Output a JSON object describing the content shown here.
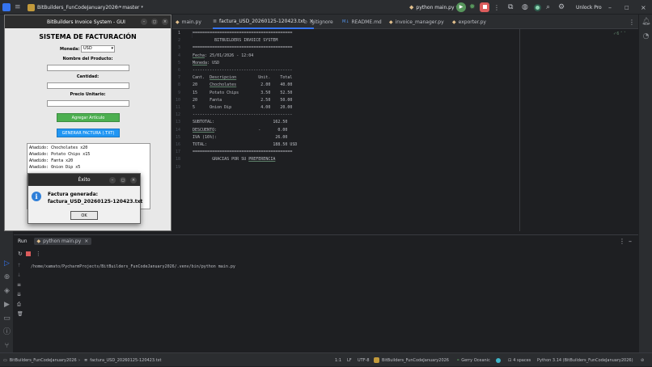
{
  "topbar": {
    "project": "BitBuilders_FunCodeJanuary2026",
    "branch": "master",
    "run_config": "python main.py",
    "unlock": "Unlock Pro"
  },
  "tabs": [
    {
      "label": "main.py",
      "icon": "python-file-icon"
    },
    {
      "label": "factura_USD_20260125-120423.txt",
      "icon": "text-file-icon",
      "active": true
    },
    {
      "label": ".gitignore",
      "icon": "ignore-file-icon"
    },
    {
      "label": "README.md",
      "icon": "markdown-file-icon"
    },
    {
      "label": "invoice_manager.py",
      "icon": "python-file-icon"
    },
    {
      "label": "exporter.py",
      "icon": "python-file-icon"
    }
  ],
  "editor": {
    "inspection_count": "6",
    "lines": [
      "=========================================",
      "         BITBUILDERS INVOICE SYSTEM",
      "=========================================",
      "Fecha: 25/01/2026 - 12:04",
      "Moneda: USD",
      "-----------------------------------------",
      "Cant.  Descripcion         Unit.    Total",
      "20     Chocholates          2.00    40.00",
      "15     Potato Chips         3.50    52.50",
      "20     Fanta                2.50    50.00",
      "5      Onion Dip            4.00    20.00",
      "-----------------------------------------",
      "SUBTOTAL:                        162.50",
      "DESCUENTO:                 -       0.00",
      "IVA (16%):                        26.00",
      "TOTAL:                           188.50 USD",
      "=========================================",
      "        GRACIAS POR SU PREFERENCIA",
      ""
    ]
  },
  "run": {
    "label": "Run",
    "tab": "python main.py",
    "command": "/home/xamato/PycharmProjects/BitBuilders_FunCodeJanuary2026/.venv/bin/python main.py"
  },
  "gui": {
    "title": "BitBuilders Invoice System - GUI",
    "heading": "SISTEMA DE FACTURACIÓN",
    "currency_label": "Moneda:",
    "currency_value": "USD",
    "product_label": "Nombre del Producto:",
    "quantity_label": "Cantidad:",
    "price_label": "Precio Unitario:",
    "add_button": "Agregar Artículo",
    "generate_button": "GENERAR FACTURA (.TXT)",
    "log": [
      "Añadido: Chocholates x20",
      "Añadido: Potato Chips x15",
      "Añadido: Fanta x20",
      "Añadido: Onion Dip x5"
    ]
  },
  "dialog": {
    "title": "Éxito",
    "line1": "Factura generada:",
    "line2": "factura_USD_20260125-120423.txt",
    "ok": "OK"
  },
  "status": {
    "project": "BitBuilders_FunCodeJanuary2026",
    "file": "factura_USD_20260125-120423.txt",
    "position": "1:1",
    "line_ending": "LF",
    "encoding": "UTF-8",
    "project2": "BitBuilders_FunCodeJanuary2026",
    "theme": "Gerry Oceanic",
    "indent": "4 spaces",
    "interpreter": "Python 3.14 (BitBuilders_FunCodeJanuary2026)"
  },
  "colors": {
    "accent": "#3574f0",
    "add_button": "#4caf50",
    "generate_button": "#2196f3",
    "run_green": "#57965c",
    "stop_red": "#db5c5c"
  }
}
